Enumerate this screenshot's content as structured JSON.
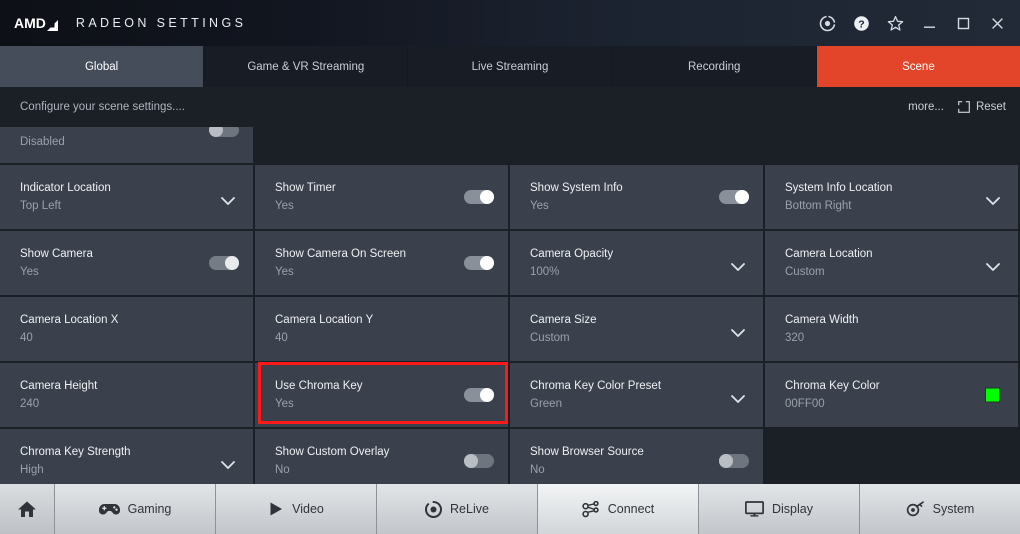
{
  "window": {
    "brand_logo": "AMD",
    "brand_title": "RADEON SETTINGS",
    "controls": [
      {
        "name": "update-icon",
        "label": "Update"
      },
      {
        "name": "help-icon",
        "label": "Help"
      },
      {
        "name": "favorite-star-icon",
        "label": "Favorite"
      },
      {
        "name": "minimize-icon",
        "label": "Minimize"
      },
      {
        "name": "maximize-icon",
        "label": "Maximize"
      },
      {
        "name": "close-icon",
        "label": "Close"
      }
    ]
  },
  "tabs": [
    {
      "label": "Global",
      "state": "selected"
    },
    {
      "label": "Game & VR Streaming",
      "state": "normal"
    },
    {
      "label": "Live Streaming",
      "state": "normal"
    },
    {
      "label": "Recording",
      "state": "normal"
    },
    {
      "label": "Scene",
      "state": "active"
    }
  ],
  "subheader": {
    "description": "Configure your scene settings....",
    "more_label": "more...",
    "reset_label": "Reset"
  },
  "settings_rows": [
    {
      "partial": true,
      "cells": [
        {
          "label": "",
          "value": "Disabled",
          "control": "toggle-off-partial"
        },
        {
          "control": "none",
          "empty": true
        },
        {
          "control": "none",
          "empty": true
        },
        {
          "control": "none",
          "empty": true
        }
      ]
    },
    {
      "partial": false,
      "cells": [
        {
          "label": "Indicator Location",
          "value": "Top Left",
          "control": "dropdown"
        },
        {
          "label": "Show Timer",
          "value": "Yes",
          "control": "toggle-on"
        },
        {
          "label": "Show System Info",
          "value": "Yes",
          "control": "toggle-on"
        },
        {
          "label": "System Info Location",
          "value": "Bottom Right",
          "control": "dropdown"
        }
      ]
    },
    {
      "partial": false,
      "cells": [
        {
          "label": "Show Camera",
          "value": "Yes",
          "control": "toggle-on-dim"
        },
        {
          "label": "Show Camera On Screen",
          "value": "Yes",
          "control": "toggle-on"
        },
        {
          "label": "Camera Opacity",
          "value": "100%",
          "control": "dropdown"
        },
        {
          "label": "Camera Location",
          "value": "Custom",
          "control": "dropdown"
        }
      ]
    },
    {
      "partial": false,
      "cells": [
        {
          "label": "Camera Location X",
          "value": "40",
          "control": "none"
        },
        {
          "label": "Camera Location Y",
          "value": "40",
          "control": "none"
        },
        {
          "label": "Camera Size",
          "value": "Custom",
          "control": "dropdown"
        },
        {
          "label": "Camera Width",
          "value": "320",
          "control": "none"
        }
      ]
    },
    {
      "partial": false,
      "cells": [
        {
          "label": "Camera Height",
          "value": "240",
          "control": "none"
        },
        {
          "label": "Use Chroma Key",
          "value": "Yes",
          "control": "toggle-on",
          "highlighted": true
        },
        {
          "label": "Chroma Key Color Preset",
          "value": "Green",
          "control": "dropdown"
        },
        {
          "label": "Chroma Key Color",
          "value": "00FF00",
          "control": "swatch",
          "swatch_color": "#00ff00"
        }
      ]
    },
    {
      "partial": false,
      "cells": [
        {
          "label": "Chroma Key Strength",
          "value": "High",
          "control": "dropdown"
        },
        {
          "label": "Show Custom Overlay",
          "value": "No",
          "control": "toggle-off"
        },
        {
          "label": "Show Browser Source",
          "value": "No",
          "control": "toggle-off"
        },
        {
          "control": "none",
          "empty": true
        }
      ]
    }
  ],
  "bottom_nav": [
    {
      "label": "",
      "icon": "home-icon",
      "active": false,
      "home": true
    },
    {
      "label": "Gaming",
      "icon": "gamepad-icon",
      "active": false
    },
    {
      "label": "Video",
      "icon": "play-icon",
      "active": false
    },
    {
      "label": "ReLive",
      "icon": "relive-record-icon",
      "active": false
    },
    {
      "label": "Connect",
      "icon": "connect-share-icon",
      "active": true
    },
    {
      "label": "Display",
      "icon": "monitor-icon",
      "active": false
    },
    {
      "label": "System",
      "icon": "system-gear-icon",
      "active": false
    }
  ],
  "colors": {
    "accent_orange": "#e2452a",
    "highlight_red": "#ff1a1a",
    "chroma_green": "#00ff00",
    "cell_bg": "#3b414c",
    "page_bg": "#1b1f26"
  }
}
